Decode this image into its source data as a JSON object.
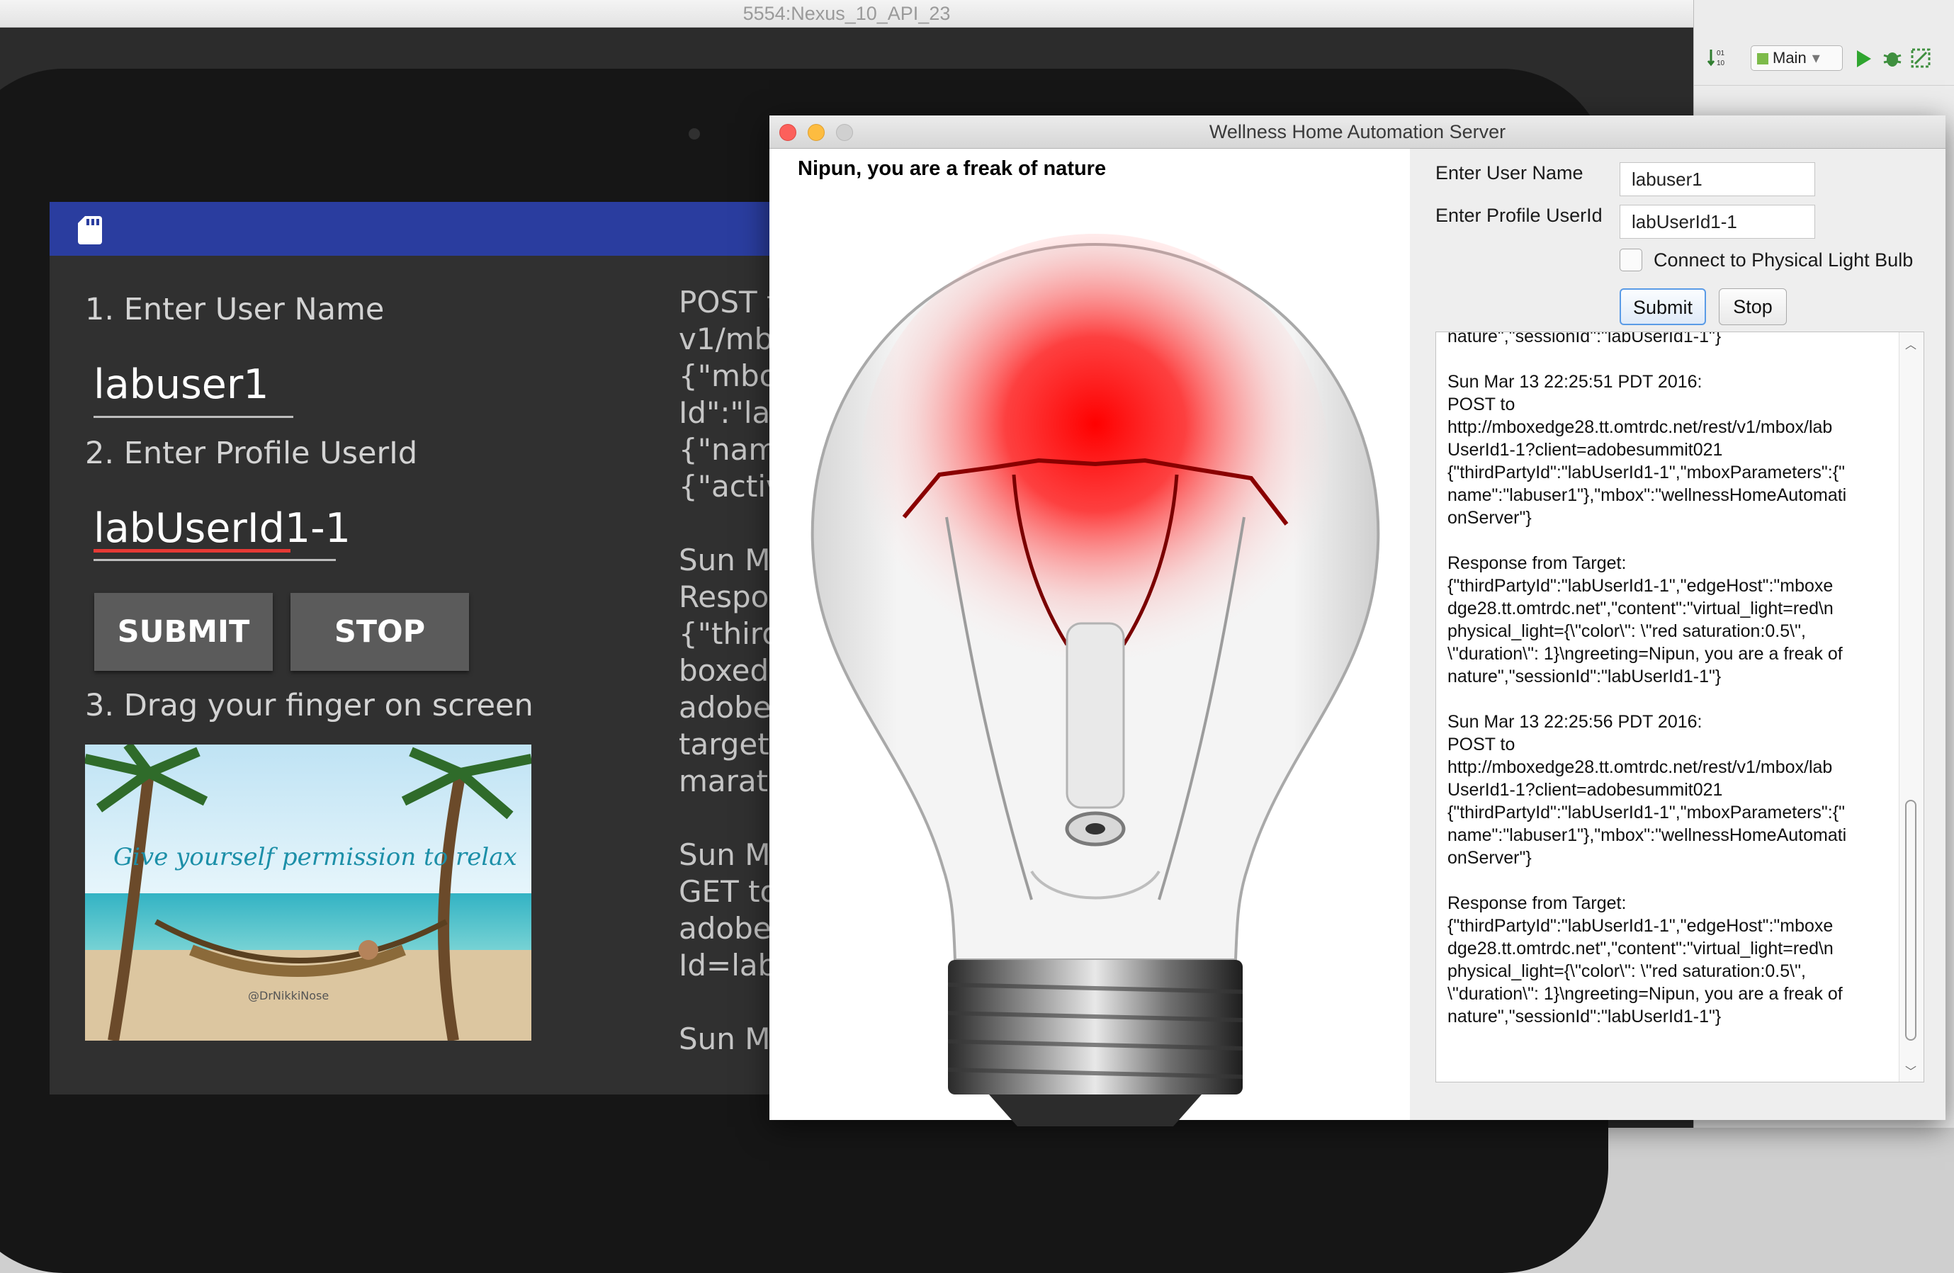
{
  "emulator": {
    "title": "5554:Nexus_10_API_23"
  },
  "android_app": {
    "label_username": "1. Enter User Name",
    "username_value": "labuser1",
    "label_userid": "2. Enter Profile UserId",
    "userid_value": "labUserId1-1",
    "submit_label": "SUBMIT",
    "stop_label": "STOP",
    "label_drag": "3. Drag your finger on screen",
    "image_caption": "Give yourself permission to relax",
    "image_credit": "@DrNikkiNose",
    "log_lines": [
      "POST t",
      "v1/mb",
      "{\"mbox",
      "Id\":\"lab",
      "{\"name",
      "{\"activ",
      "",
      "Sun Ma",
      "Respo",
      "{\"thirdF",
      "boxedg",
      "adobe-",
      "target-",
      "marath",
      "",
      "Sun Ma",
      "GET to",
      "adobes",
      "Id=labU",
      "",
      "Sun Ma"
    ]
  },
  "studio": {
    "run_config": "Main",
    "colors": {
      "run": "#2fa52f",
      "debug": "#3f8f3f"
    }
  },
  "server_window": {
    "title": "Wellness Home Automation Server",
    "greeting": "Nipun, you are a freak of nature",
    "label_username": "Enter User Name",
    "label_userid": "Enter Profile UserId",
    "username_value": "labuser1",
    "userid_value": "labUserId1-1",
    "checkbox_label": "Connect to Physical Light Bulb",
    "checkbox_checked": false,
    "submit_label": "Submit",
    "stop_label": "Stop",
    "bulb_color": "#ff0000",
    "log_lines": [
      "nature\",\"sessionId\":\"labUserId1-1\"}",
      "",
      "Sun Mar 13 22:25:51 PDT 2016:",
      "POST to",
      "http://mboxedge28.tt.omtrdc.net/rest/v1/mbox/lab",
      "UserId1-1?client=adobesummit021",
      "{\"thirdPartyId\":\"labUserId1-1\",\"mboxParameters\":{\"",
      "name\":\"labuser1\"},\"mbox\":\"wellnessHomeAutomati",
      "onServer\"}",
      "",
      "Response from Target:",
      "{\"thirdPartyId\":\"labUserId1-1\",\"edgeHost\":\"mboxe",
      "dge28.tt.omtrdc.net\",\"content\":\"virtual_light=red\\n",
      "physical_light={\\\"color\\\": \\\"red saturation:0.5\\\",",
      "\\\"duration\\\": 1}\\ngreeting=Nipun, you are a freak of",
      "nature\",\"sessionId\":\"labUserId1-1\"}",
      "",
      "Sun Mar 13 22:25:56 PDT 2016:",
      "POST to",
      "http://mboxedge28.tt.omtrdc.net/rest/v1/mbox/lab",
      "UserId1-1?client=adobesummit021",
      "{\"thirdPartyId\":\"labUserId1-1\",\"mboxParameters\":{\"",
      "name\":\"labuser1\"},\"mbox\":\"wellnessHomeAutomati",
      "onServer\"}",
      "",
      "Response from Target:",
      "{\"thirdPartyId\":\"labUserId1-1\",\"edgeHost\":\"mboxe",
      "dge28.tt.omtrdc.net\",\"content\":\"virtual_light=red\\n",
      "physical_light={\\\"color\\\": \\\"red saturation:0.5\\\",",
      "\\\"duration\\\": 1}\\ngreeting=Nipun, you are a freak of",
      "nature\",\"sessionId\":\"labUserId1-1\"}"
    ]
  }
}
